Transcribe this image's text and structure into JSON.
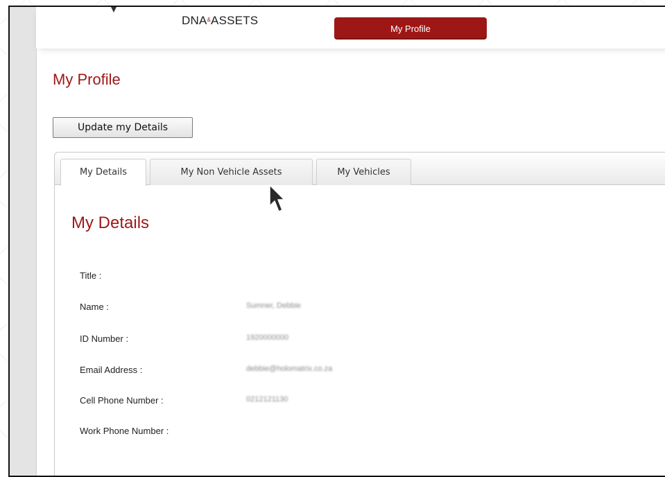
{
  "brand": {
    "logo_text_left": "DNA",
    "logo_text_mid": "&",
    "logo_text_right": "ASSETS"
  },
  "nav": {
    "active_tab": "My Profile"
  },
  "page": {
    "title": "My Profile"
  },
  "toolbar": {
    "update_label": "Update my Details"
  },
  "tabs": [
    {
      "label": "My Details",
      "active": true
    },
    {
      "label": "My Non Vehicle Assets",
      "active": false
    },
    {
      "label": "My Vehicles",
      "active": false
    }
  ],
  "details": {
    "section_title": "My Details",
    "fields": [
      {
        "label": "Title :",
        "value": ""
      },
      {
        "label": "Name :",
        "value": "Sumner, Debbie"
      },
      {
        "label": "ID Number :",
        "value": "1920000000"
      },
      {
        "label": "Email Address :",
        "value": "debbie@holomatrix.co.za"
      },
      {
        "label": "Cell Phone Number :",
        "value": "0212121130"
      },
      {
        "label": "Work Phone Number :",
        "value": ""
      }
    ]
  },
  "colors": {
    "brand_red": "#9e1717"
  }
}
